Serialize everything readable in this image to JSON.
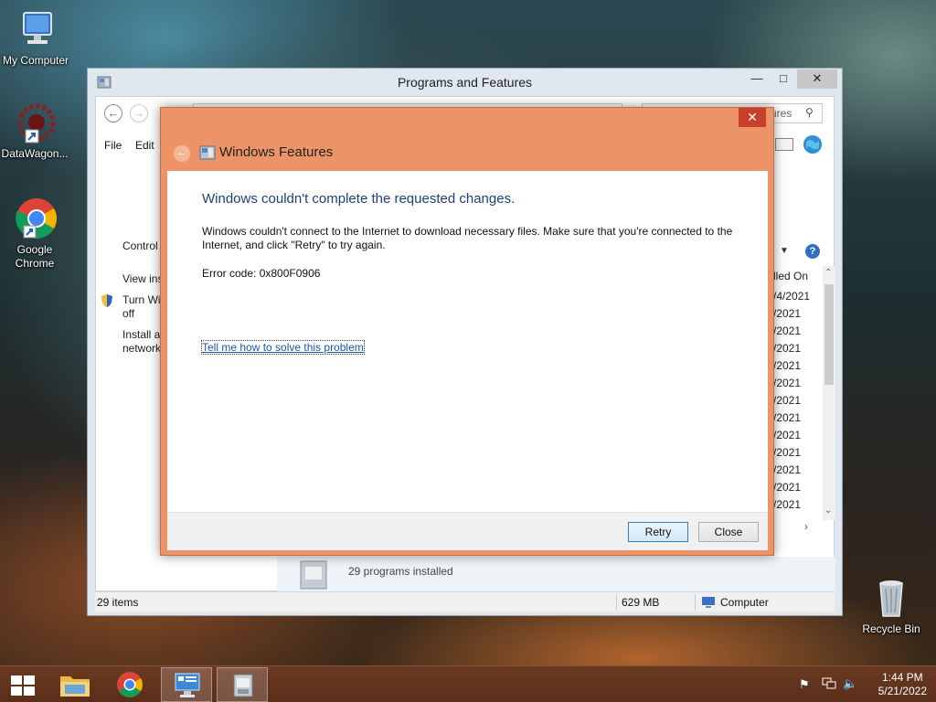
{
  "desktop": {
    "icons": [
      {
        "label": "My Computer"
      },
      {
        "label": "DataWagon..."
      },
      {
        "label": "Google Chrome"
      },
      {
        "label": "Recycle Bin"
      }
    ]
  },
  "programs_window": {
    "title": "Programs and Features",
    "search_fragment": "ures",
    "menu": {
      "file": "File",
      "edit": "Edit"
    },
    "left_links": {
      "control": "Control",
      "view": "View ins",
      "turn_windows": "Turn Wi",
      "turn_off": "off",
      "install": "Install a",
      "network": "network"
    },
    "column_header": "lled On",
    "dates": [
      "/4/2021",
      "/2021",
      "/2021",
      "/2021",
      "/2021",
      "/2021",
      "/2021",
      "/2021",
      "/2021",
      "/2021",
      "/2021",
      "/2021",
      "/2021"
    ],
    "footer_info": "29 programs installed",
    "status": {
      "items": "29 items",
      "size": "629 MB",
      "location": "Computer"
    }
  },
  "dialog": {
    "title": "Windows Features",
    "heading": "Windows couldn't complete the requested changes.",
    "message": "Windows couldn't connect to the Internet to download necessary files. Make sure that you're connected to the Internet, and click \"Retry\" to try again.",
    "error_code": "Error code: 0x800F0906",
    "help_link": "Tell me how to solve this problem",
    "retry_label": "Retry",
    "close_label": "Close"
  },
  "taskbar": {
    "time": "1:44 PM",
    "date": "5/21/2022"
  },
  "colors": {
    "dialog_frame": "#ec9468",
    "close_button": "#c7402c",
    "heading_blue": "#1e3f7c",
    "link_blue": "#1a5aa8",
    "taskbar": "#5a2e18"
  }
}
